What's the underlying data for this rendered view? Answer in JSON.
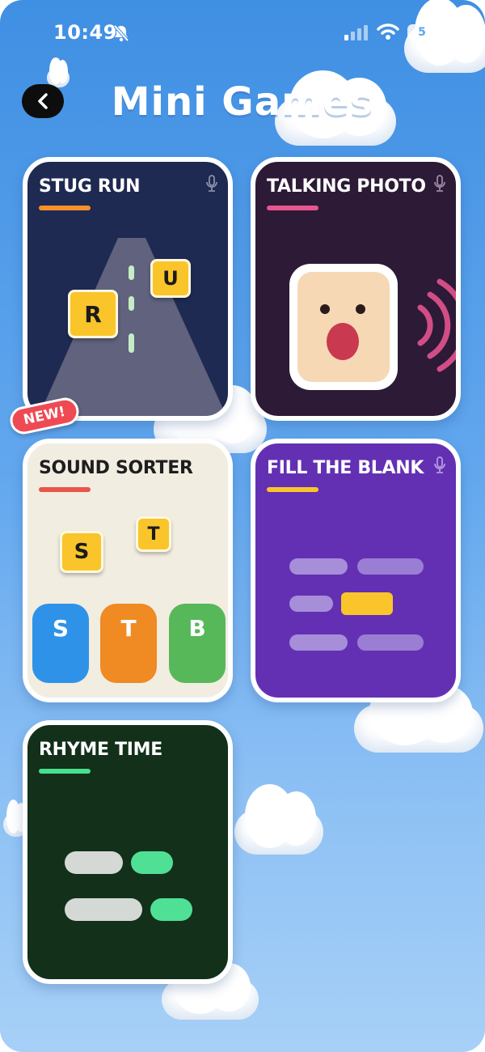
{
  "status_bar": {
    "time": "10:49",
    "battery": "5"
  },
  "header": {
    "title": "Mini Games"
  },
  "badge_new": "NEW!",
  "cards": {
    "stug_run": {
      "title": "STUG RUN",
      "letters": [
        "R",
        "U"
      ],
      "accent": "#f5902a"
    },
    "talking_photo": {
      "title": "TALKING PHOTO",
      "accent": "#e8558e"
    },
    "sound_sorter": {
      "title": "SOUND SORTER",
      "tiles": [
        "S",
        "T"
      ],
      "bins": [
        "S",
        "T",
        "B"
      ],
      "accent": "#e8554a"
    },
    "fill_the_blank": {
      "title": "FILL THE BLANK",
      "accent": "#f9c52a"
    },
    "rhyme_time": {
      "title": "RHYME TIME",
      "accent": "#47e08e"
    }
  }
}
